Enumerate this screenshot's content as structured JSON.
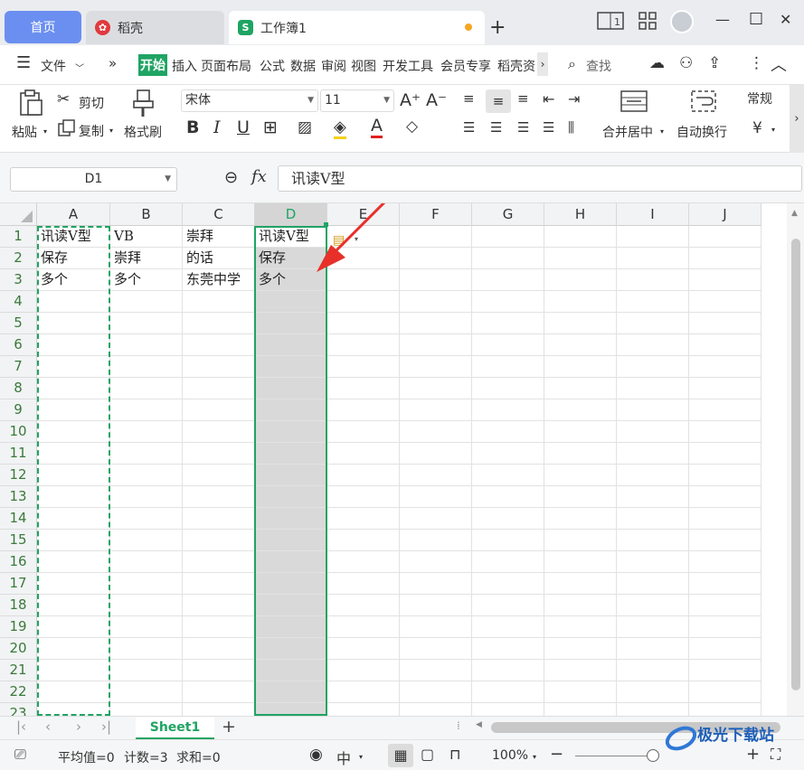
{
  "tabs": {
    "home": "首页",
    "daoke": "稻壳",
    "workbook": "工作簿1",
    "workbook_icon": "S",
    "add": "+"
  },
  "window_controls": {
    "minimize": "—",
    "maximize": "☐",
    "close": "✕"
  },
  "menu": {
    "file": "文件",
    "items": [
      "开始",
      "插入",
      "页面布局",
      "公式",
      "数据",
      "审阅",
      "视图",
      "开发工具",
      "会员专享",
      "稻壳资"
    ],
    "search": "查找"
  },
  "ribbon": {
    "paste": "粘贴",
    "cut": "剪切",
    "copy": "复制",
    "format_painter": "格式刷",
    "font_name": "宋体",
    "font_size": "11",
    "merge_center": "合并居中",
    "wrap_text": "自动换行",
    "number_format": "常规",
    "currency": "¥"
  },
  "formula_bar": {
    "name_box": "D1",
    "fx": "fx",
    "content": "讯读V型"
  },
  "columns": [
    "A",
    "B",
    "C",
    "D",
    "E",
    "F",
    "G",
    "H",
    "I",
    "J"
  ],
  "rows": [
    "1",
    "2",
    "3",
    "4",
    "5",
    "6",
    "7",
    "8",
    "9",
    "10",
    "11",
    "12",
    "13",
    "14",
    "15",
    "16",
    "17",
    "18",
    "19",
    "20",
    "21",
    "22",
    "23"
  ],
  "cells": {
    "A1": "讯读V型",
    "B1": "VB",
    "C1": "崇拜",
    "D1": "讯读V型",
    "A2": "保存",
    "B2": "崇拜",
    "C2": "的话",
    "D2": "保存",
    "A3": "多个",
    "B3": "多个",
    "C3": "东莞中学",
    "D3": "多个"
  },
  "sheet": {
    "name": "Sheet1",
    "add": "+"
  },
  "status": {
    "average": "平均值=0",
    "count": "计数=3",
    "sum": "求和=0",
    "zoom": "100%"
  },
  "watermark": "极光下载站",
  "colors": {
    "accent": "#1fa463",
    "selection": "#d9d9d9",
    "home_tab": "#6b8ff0",
    "arrow": "#e8302a"
  }
}
